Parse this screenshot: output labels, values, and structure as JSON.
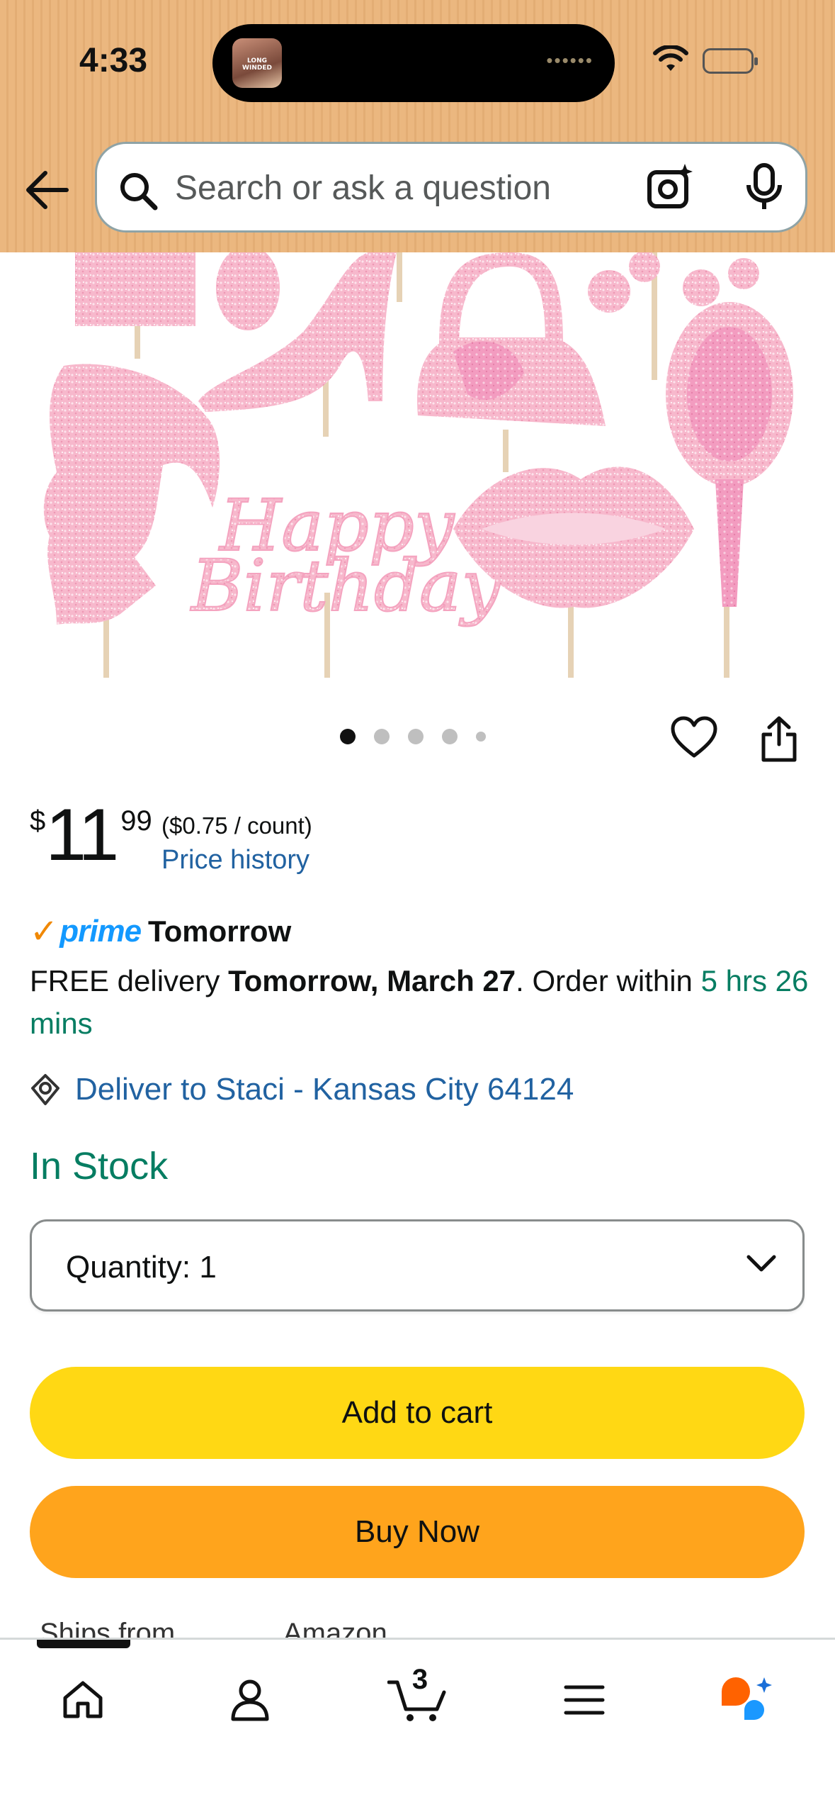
{
  "status_bar": {
    "time": "4:33",
    "now_playing_art_text": "LONG WINDED"
  },
  "search": {
    "placeholder": "Search or ask a question"
  },
  "carousel": {
    "count": 5,
    "active_index": 0
  },
  "price": {
    "symbol": "$",
    "whole": "11",
    "fraction": "99",
    "unit_price": "($0.75 / count)",
    "history_link": "Price history"
  },
  "prime": {
    "check": "✓",
    "word": "prime",
    "label": "Tomorrow"
  },
  "delivery": {
    "prefix": "FREE delivery ",
    "date": "Tomorrow, March 27",
    "middle": ". Order within ",
    "countdown": "5 hrs 26 mins"
  },
  "deliver_to": "Deliver to Staci - Kansas City 64124",
  "stock_status": "In Stock",
  "quantity": {
    "label": "Quantity:",
    "value": "1"
  },
  "buttons": {
    "add_to_cart": "Add to cart",
    "buy_now": "Buy Now"
  },
  "ships": {
    "label": "Ships from",
    "value": "Amazon"
  },
  "tabbar": {
    "cart_count": "3"
  },
  "colors": {
    "header_bg": "#ebb77f",
    "add_to_cart": "#ffd814",
    "buy_now": "#ffa41c",
    "link": "#2162a1",
    "success_green": "#067d62",
    "prime_blue": "#1399ff"
  }
}
